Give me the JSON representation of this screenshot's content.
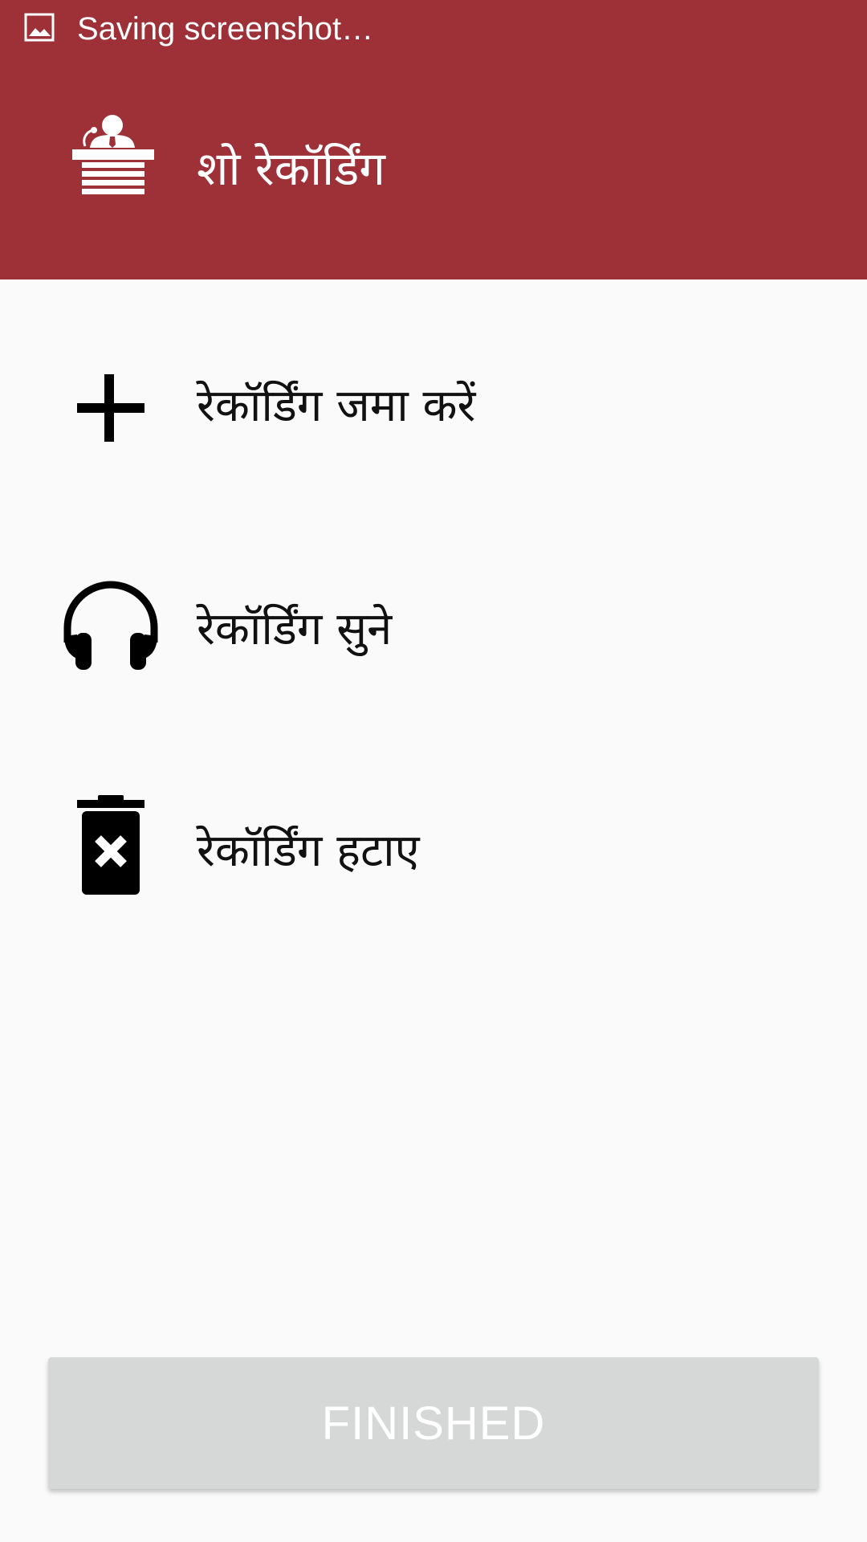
{
  "status_bar": {
    "notification_icon": "image-icon",
    "text": "Saving screenshot…"
  },
  "header": {
    "icon": "podium-speaker-icon",
    "title": "शो रेकॉर्डिंग",
    "background_color": "#9e3038"
  },
  "menu": {
    "items": [
      {
        "icon": "plus-icon",
        "label": "रेकॉर्डिंग जमा करें"
      },
      {
        "icon": "headphones-icon",
        "label": "रेकॉर्डिंग सुने"
      },
      {
        "icon": "trash-delete-icon",
        "label": "रेकॉर्डिंग हटाए"
      }
    ]
  },
  "footer": {
    "finished_label": "FINISHED",
    "button_color": "#d6d7d7"
  }
}
